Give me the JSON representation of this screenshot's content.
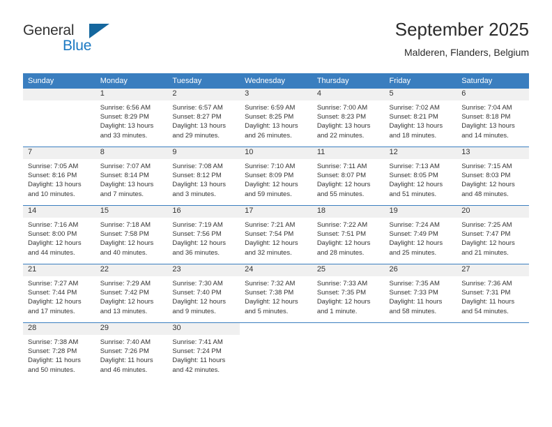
{
  "brand": {
    "name_part1": "General",
    "name_part2": "Blue",
    "triangle_color": "#15679e",
    "blue_color": "#1a78c2"
  },
  "header": {
    "title": "September 2025",
    "subtitle": "Malderen, Flanders, Belgium"
  },
  "theme": {
    "header_blue": "#3a7ebf",
    "daynum_band": "#f0f0f0",
    "text": "#333333"
  },
  "weekday_headers": [
    "Sunday",
    "Monday",
    "Tuesday",
    "Wednesday",
    "Thursday",
    "Friday",
    "Saturday"
  ],
  "weeks": [
    [
      {
        "day": "",
        "sunrise": "",
        "sunset": "",
        "daylight_line1": "",
        "daylight_line2": ""
      },
      {
        "day": "1",
        "sunrise": "Sunrise: 6:56 AM",
        "sunset": "Sunset: 8:29 PM",
        "daylight_line1": "Daylight: 13 hours",
        "daylight_line2": "and 33 minutes."
      },
      {
        "day": "2",
        "sunrise": "Sunrise: 6:57 AM",
        "sunset": "Sunset: 8:27 PM",
        "daylight_line1": "Daylight: 13 hours",
        "daylight_line2": "and 29 minutes."
      },
      {
        "day": "3",
        "sunrise": "Sunrise: 6:59 AM",
        "sunset": "Sunset: 8:25 PM",
        "daylight_line1": "Daylight: 13 hours",
        "daylight_line2": "and 26 minutes."
      },
      {
        "day": "4",
        "sunrise": "Sunrise: 7:00 AM",
        "sunset": "Sunset: 8:23 PM",
        "daylight_line1": "Daylight: 13 hours",
        "daylight_line2": "and 22 minutes."
      },
      {
        "day": "5",
        "sunrise": "Sunrise: 7:02 AM",
        "sunset": "Sunset: 8:21 PM",
        "daylight_line1": "Daylight: 13 hours",
        "daylight_line2": "and 18 minutes."
      },
      {
        "day": "6",
        "sunrise": "Sunrise: 7:04 AM",
        "sunset": "Sunset: 8:18 PM",
        "daylight_line1": "Daylight: 13 hours",
        "daylight_line2": "and 14 minutes."
      }
    ],
    [
      {
        "day": "7",
        "sunrise": "Sunrise: 7:05 AM",
        "sunset": "Sunset: 8:16 PM",
        "daylight_line1": "Daylight: 13 hours",
        "daylight_line2": "and 10 minutes."
      },
      {
        "day": "8",
        "sunrise": "Sunrise: 7:07 AM",
        "sunset": "Sunset: 8:14 PM",
        "daylight_line1": "Daylight: 13 hours",
        "daylight_line2": "and 7 minutes."
      },
      {
        "day": "9",
        "sunrise": "Sunrise: 7:08 AM",
        "sunset": "Sunset: 8:12 PM",
        "daylight_line1": "Daylight: 13 hours",
        "daylight_line2": "and 3 minutes."
      },
      {
        "day": "10",
        "sunrise": "Sunrise: 7:10 AM",
        "sunset": "Sunset: 8:09 PM",
        "daylight_line1": "Daylight: 12 hours",
        "daylight_line2": "and 59 minutes."
      },
      {
        "day": "11",
        "sunrise": "Sunrise: 7:11 AM",
        "sunset": "Sunset: 8:07 PM",
        "daylight_line1": "Daylight: 12 hours",
        "daylight_line2": "and 55 minutes."
      },
      {
        "day": "12",
        "sunrise": "Sunrise: 7:13 AM",
        "sunset": "Sunset: 8:05 PM",
        "daylight_line1": "Daylight: 12 hours",
        "daylight_line2": "and 51 minutes."
      },
      {
        "day": "13",
        "sunrise": "Sunrise: 7:15 AM",
        "sunset": "Sunset: 8:03 PM",
        "daylight_line1": "Daylight: 12 hours",
        "daylight_line2": "and 48 minutes."
      }
    ],
    [
      {
        "day": "14",
        "sunrise": "Sunrise: 7:16 AM",
        "sunset": "Sunset: 8:00 PM",
        "daylight_line1": "Daylight: 12 hours",
        "daylight_line2": "and 44 minutes."
      },
      {
        "day": "15",
        "sunrise": "Sunrise: 7:18 AM",
        "sunset": "Sunset: 7:58 PM",
        "daylight_line1": "Daylight: 12 hours",
        "daylight_line2": "and 40 minutes."
      },
      {
        "day": "16",
        "sunrise": "Sunrise: 7:19 AM",
        "sunset": "Sunset: 7:56 PM",
        "daylight_line1": "Daylight: 12 hours",
        "daylight_line2": "and 36 minutes."
      },
      {
        "day": "17",
        "sunrise": "Sunrise: 7:21 AM",
        "sunset": "Sunset: 7:54 PM",
        "daylight_line1": "Daylight: 12 hours",
        "daylight_line2": "and 32 minutes."
      },
      {
        "day": "18",
        "sunrise": "Sunrise: 7:22 AM",
        "sunset": "Sunset: 7:51 PM",
        "daylight_line1": "Daylight: 12 hours",
        "daylight_line2": "and 28 minutes."
      },
      {
        "day": "19",
        "sunrise": "Sunrise: 7:24 AM",
        "sunset": "Sunset: 7:49 PM",
        "daylight_line1": "Daylight: 12 hours",
        "daylight_line2": "and 25 minutes."
      },
      {
        "day": "20",
        "sunrise": "Sunrise: 7:25 AM",
        "sunset": "Sunset: 7:47 PM",
        "daylight_line1": "Daylight: 12 hours",
        "daylight_line2": "and 21 minutes."
      }
    ],
    [
      {
        "day": "21",
        "sunrise": "Sunrise: 7:27 AM",
        "sunset": "Sunset: 7:44 PM",
        "daylight_line1": "Daylight: 12 hours",
        "daylight_line2": "and 17 minutes."
      },
      {
        "day": "22",
        "sunrise": "Sunrise: 7:29 AM",
        "sunset": "Sunset: 7:42 PM",
        "daylight_line1": "Daylight: 12 hours",
        "daylight_line2": "and 13 minutes."
      },
      {
        "day": "23",
        "sunrise": "Sunrise: 7:30 AM",
        "sunset": "Sunset: 7:40 PM",
        "daylight_line1": "Daylight: 12 hours",
        "daylight_line2": "and 9 minutes."
      },
      {
        "day": "24",
        "sunrise": "Sunrise: 7:32 AM",
        "sunset": "Sunset: 7:38 PM",
        "daylight_line1": "Daylight: 12 hours",
        "daylight_line2": "and 5 minutes."
      },
      {
        "day": "25",
        "sunrise": "Sunrise: 7:33 AM",
        "sunset": "Sunset: 7:35 PM",
        "daylight_line1": "Daylight: 12 hours",
        "daylight_line2": "and 1 minute."
      },
      {
        "day": "26",
        "sunrise": "Sunrise: 7:35 AM",
        "sunset": "Sunset: 7:33 PM",
        "daylight_line1": "Daylight: 11 hours",
        "daylight_line2": "and 58 minutes."
      },
      {
        "day": "27",
        "sunrise": "Sunrise: 7:36 AM",
        "sunset": "Sunset: 7:31 PM",
        "daylight_line1": "Daylight: 11 hours",
        "daylight_line2": "and 54 minutes."
      }
    ],
    [
      {
        "day": "28",
        "sunrise": "Sunrise: 7:38 AM",
        "sunset": "Sunset: 7:28 PM",
        "daylight_line1": "Daylight: 11 hours",
        "daylight_line2": "and 50 minutes."
      },
      {
        "day": "29",
        "sunrise": "Sunrise: 7:40 AM",
        "sunset": "Sunset: 7:26 PM",
        "daylight_line1": "Daylight: 11 hours",
        "daylight_line2": "and 46 minutes."
      },
      {
        "day": "30",
        "sunrise": "Sunrise: 7:41 AM",
        "sunset": "Sunset: 7:24 PM",
        "daylight_line1": "Daylight: 11 hours",
        "daylight_line2": "and 42 minutes."
      },
      {
        "day": "",
        "sunrise": "",
        "sunset": "",
        "daylight_line1": "",
        "daylight_line2": ""
      },
      {
        "day": "",
        "sunrise": "",
        "sunset": "",
        "daylight_line1": "",
        "daylight_line2": ""
      },
      {
        "day": "",
        "sunrise": "",
        "sunset": "",
        "daylight_line1": "",
        "daylight_line2": ""
      },
      {
        "day": "",
        "sunrise": "",
        "sunset": "",
        "daylight_line1": "",
        "daylight_line2": ""
      }
    ]
  ]
}
